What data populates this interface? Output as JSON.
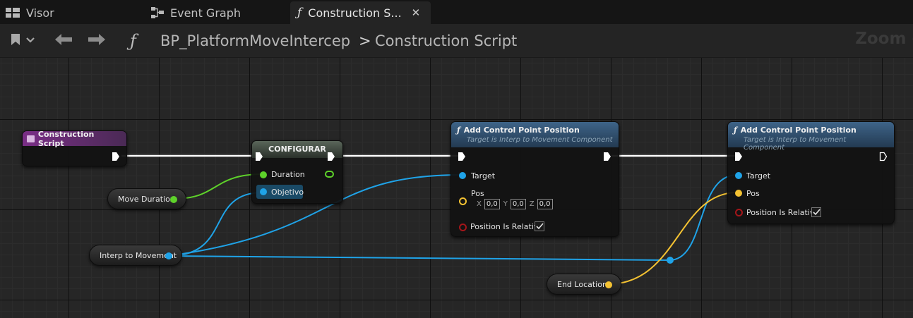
{
  "tabs": [
    {
      "label": "Visor",
      "icon": "viewport-icon"
    },
    {
      "label": "Event Graph",
      "icon": "event-graph-icon"
    },
    {
      "label": "Construction S...",
      "icon": "function-icon",
      "active": true
    }
  ],
  "toolbar": {
    "bookmark_icon": "bookmark-icon",
    "breadcrumb_blueprint": "BP_PlatformMoveIntercep",
    "breadcrumb_separator": ">",
    "breadcrumb_current": "Construction Script",
    "zoom_label": "Zoom -"
  },
  "nodes": {
    "construction_script": {
      "title": "Construction Script"
    },
    "configurar": {
      "title": "CONFIGURAR",
      "pin_duration": "Duration",
      "pin_objetivo": "Objetivo"
    },
    "add_cp1": {
      "title": "Add Control Point Position",
      "subtitle": "Target is Interp to Movement Component",
      "pin_target": "Target",
      "pin_pos": "Pos",
      "x_label": "X",
      "x_value": "0,0",
      "y_label": "Y",
      "y_value": "0,0",
      "z_label": "Z",
      "z_value": "0,0",
      "pin_relative": "Position Is Relative",
      "relative_checked": true
    },
    "add_cp2": {
      "title": "Add Control Point Position",
      "subtitle": "Target is Interp to Movement Component",
      "pin_target": "Target",
      "pin_pos": "Pos",
      "pin_relative": "Position Is Relative",
      "relative_checked": true
    }
  },
  "variables": {
    "move_duration": "Move Duration",
    "interp_to_movement": "Interp to Movement",
    "end_location": "End Location"
  },
  "colors": {
    "exec": "#ffffff",
    "float": "#5ed22a",
    "object": "#1fa3e8",
    "vector": "#f4c232",
    "bool": "#a4161a",
    "function_header": "#2e4a66",
    "event_header": "#7a2e86",
    "setter_header": "#4d5a4d"
  }
}
